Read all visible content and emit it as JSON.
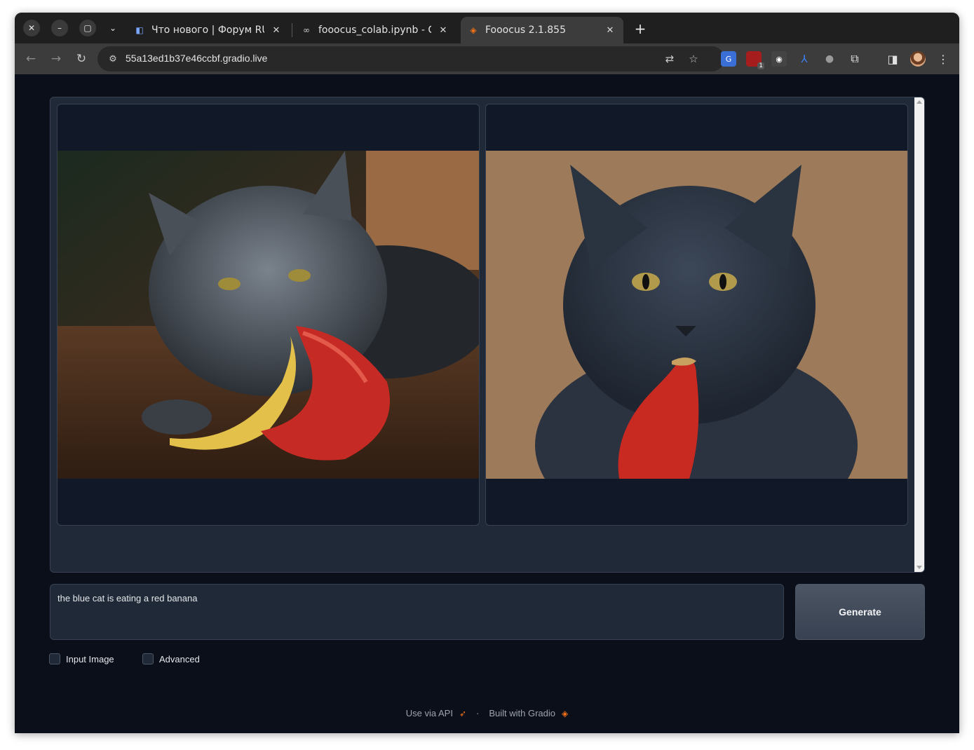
{
  "browser": {
    "tabs": [
      {
        "title": "Что нового | Форум RUD",
        "favicon": "forum-icon",
        "active": false
      },
      {
        "title": "fooocus_colab.ipynb - Co",
        "favicon": "colab-icon",
        "active": false
      },
      {
        "title": "Fooocus 2.1.855",
        "favicon": "gradio-icon",
        "active": true
      }
    ],
    "url": "55a13ed1b37e46ccbf.gradio.live",
    "extension_badge": "1"
  },
  "gallery": {
    "images": [
      {
        "description_icon": "cat-banana-image-1"
      },
      {
        "description_icon": "cat-banana-image-2"
      }
    ]
  },
  "prompt": {
    "value": "the blue cat is eating a red banana"
  },
  "generate_label": "Generate",
  "checkboxes": {
    "input_image": "Input Image",
    "advanced": "Advanced"
  },
  "footer": {
    "api_link": "Use via API",
    "separator": "·",
    "built_with": "Built with Gradio"
  },
  "colors": {
    "background": "#0b0f19",
    "panel": "#1f2937",
    "border": "#374151",
    "accent": "#f97316"
  }
}
